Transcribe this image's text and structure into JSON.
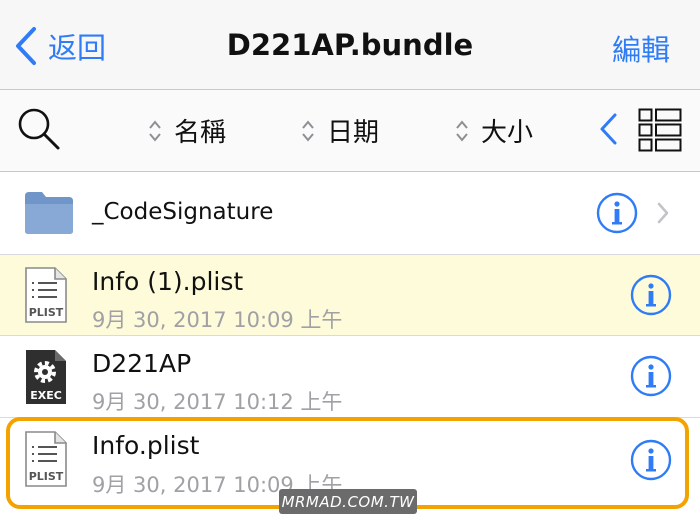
{
  "navbar": {
    "back_label": "返回",
    "title": "D221AP.bundle",
    "edit_label": "編輯"
  },
  "toolbar": {
    "sort_options": [
      {
        "label": "名稱"
      },
      {
        "label": "日期"
      },
      {
        "label": "大小"
      }
    ]
  },
  "files": [
    {
      "name": "_CodeSignature",
      "type": "folder",
      "date": ""
    },
    {
      "name": "Info (1).plist",
      "type": "plist",
      "date": "9月 30, 2017 10:09 上午",
      "icon_text": "PLIST",
      "highlighted": true
    },
    {
      "name": "D221AP",
      "type": "exec",
      "date": "9月 30, 2017 10:12 上午",
      "icon_text": "EXEC"
    },
    {
      "name": "Info.plist",
      "type": "plist",
      "date": "9月 30, 2017 10:09 上午",
      "icon_text": "PLIST",
      "selected": true
    }
  ],
  "watermark": "MRMAD.COM.TW",
  "colors": {
    "accent": "#2f7cf6",
    "highlight_row": "#fdfbd9",
    "selection_frame": "#f3a300",
    "secondary_text": "#a0a0a5"
  }
}
